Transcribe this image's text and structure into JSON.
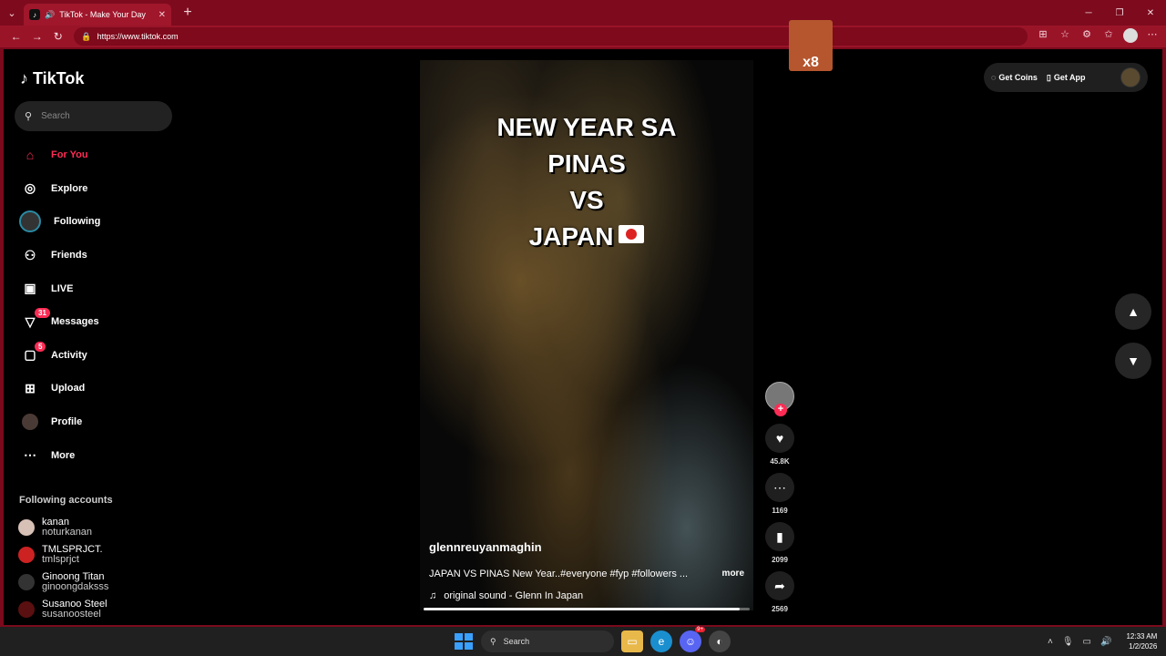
{
  "browser": {
    "tab_title": "TikTok - Make Your Day",
    "url": "https://www.tiktok.com"
  },
  "sticker_text": "x8",
  "logo_text": "TikTok",
  "search": {
    "placeholder": "Search"
  },
  "nav": [
    {
      "label": "For You",
      "icon": "home-icon",
      "active": true
    },
    {
      "label": "Explore",
      "icon": "compass-icon"
    },
    {
      "label": "Following",
      "icon": "following-avatar"
    },
    {
      "label": "Friends",
      "icon": "friends-icon"
    },
    {
      "label": "LIVE",
      "icon": "live-icon"
    },
    {
      "label": "Messages",
      "icon": "messages-icon",
      "badge": "31"
    },
    {
      "label": "Activity",
      "icon": "activity-icon",
      "badge": "5"
    },
    {
      "label": "Upload",
      "icon": "upload-icon"
    },
    {
      "label": "Profile",
      "icon": "profile-avatar"
    },
    {
      "label": "More",
      "icon": "more-icon"
    }
  ],
  "following_title": "Following accounts",
  "following": [
    {
      "name": "kanan",
      "handle": "noturkanan"
    },
    {
      "name": "TMLSPRJCT.",
      "handle": "tmlsprjct"
    },
    {
      "name": "Ginoong Titan",
      "handle": "ginoongdaksss"
    },
    {
      "name": "Susanoo Steel",
      "handle": "susanoosteel"
    }
  ],
  "topright": {
    "coins": "Get Coins",
    "app": "Get App"
  },
  "video": {
    "overlay_lines": [
      "NEW YEAR SA",
      "PINAS",
      "VS",
      "JAPAN"
    ],
    "username": "glennreuyanmaghin",
    "caption": "JAPAN VS PINAS New Year..#everyone #fyp #followers ...",
    "more": "more",
    "sound": "original sound - Glenn In Japan",
    "progress": 0.97
  },
  "actions": {
    "likes": "45.8K",
    "comments": "1169",
    "saves": "2099",
    "shares": "2569"
  },
  "taskbar": {
    "search": "Search",
    "discord_badge": "9+",
    "time": "12:33 AM",
    "date": "1/2/2026"
  },
  "colors": {
    "accent": "#fe2c55",
    "frame": "#9a1428"
  }
}
